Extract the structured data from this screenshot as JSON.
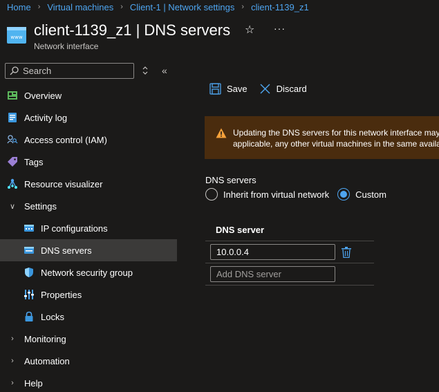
{
  "breadcrumb": {
    "items": [
      "Home",
      "Virtual machines",
      "Client-1 | Network settings",
      "client-1139_z1"
    ]
  },
  "header": {
    "icon": "network-interface-icon",
    "title": "client-1139_z1 | DNS servers",
    "subtitle": "Network interface",
    "favorite_icon": "star-icon",
    "more_label": "···"
  },
  "sidebar": {
    "search_placeholder": "Search",
    "collapse_label": "«",
    "items": [
      {
        "label": "Overview",
        "icon": "overview-icon"
      },
      {
        "label": "Activity log",
        "icon": "activity-log-icon"
      },
      {
        "label": "Access control (IAM)",
        "icon": "iam-icon"
      },
      {
        "label": "Tags",
        "icon": "tag-icon"
      },
      {
        "label": "Resource visualizer",
        "icon": "visualizer-icon"
      },
      {
        "label": "Settings",
        "expanded": true
      },
      {
        "label": "IP configurations",
        "icon": "ip-config-icon"
      },
      {
        "label": "DNS servers",
        "icon": "dns-icon",
        "active": true
      },
      {
        "label": "Network security group",
        "icon": "shield-icon"
      },
      {
        "label": "Properties",
        "icon": "properties-icon"
      },
      {
        "label": "Locks",
        "icon": "lock-icon"
      },
      {
        "label": "Monitoring",
        "expanded": false
      },
      {
        "label": "Automation",
        "expanded": false
      },
      {
        "label": "Help",
        "expanded": false
      }
    ]
  },
  "toolbar": {
    "save_label": "Save",
    "discard_label": "Discard"
  },
  "warning": {
    "line1": "Updating the DNS servers for this network interface may",
    "line2": "applicable, any other virtual machines in the same availa"
  },
  "dns": {
    "heading": "DNS servers",
    "option_inherit": "Inherit from virtual network",
    "option_custom": "Custom",
    "selected": "Custom",
    "column_header": "DNS server",
    "servers": [
      "10.0.0.4"
    ],
    "add_placeholder": "Add DNS server"
  },
  "colors": {
    "accent": "#4ea5f0",
    "warning_bg": "#4a2c0e",
    "warning_icon": "#fce100"
  }
}
